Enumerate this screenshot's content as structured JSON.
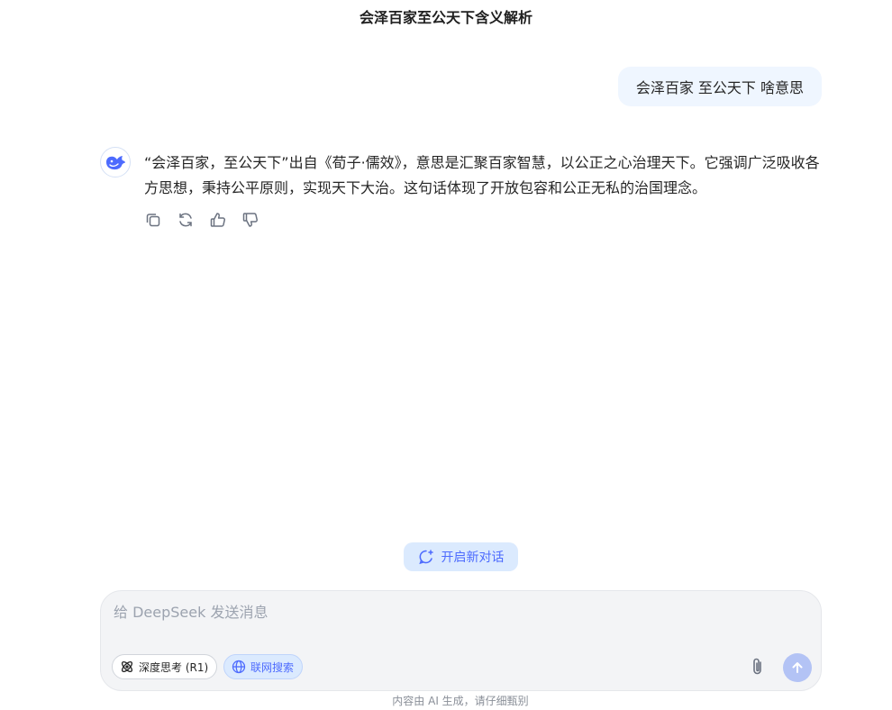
{
  "header": {
    "title": "会泽百家至公天下含义解析"
  },
  "conversation": {
    "user_message": "会泽百家 至公天下 啥意思",
    "assistant_message": "“会泽百家，至公天下”出自《荀子·儒效》，意思是汇聚百家智慧，以公正之心治理天下。它强调广泛吸收各方思想，秉持公平原则，实现天下大治。这句话体现了开放包容和公正无私的治国理念。",
    "assistant_avatar_icon": "deepseek-whale-icon",
    "action_icons": [
      "copy-icon",
      "regenerate-icon",
      "thumbs-up-icon",
      "thumbs-down-icon"
    ]
  },
  "new_chat": {
    "label": "开启新对话",
    "icon": "new-chat-icon"
  },
  "composer": {
    "placeholder": "给 DeepSeek 发送消息",
    "value": "",
    "deep_think_label": "深度思考 (R1)",
    "web_search_label": "联网搜索"
  },
  "footer": {
    "disclaimer": "内容由 AI 生成，请仔细甄别"
  },
  "colors": {
    "accent": "#4d6bfe",
    "user_bubble": "#eff6ff",
    "chip_active": "#dbeafe"
  }
}
